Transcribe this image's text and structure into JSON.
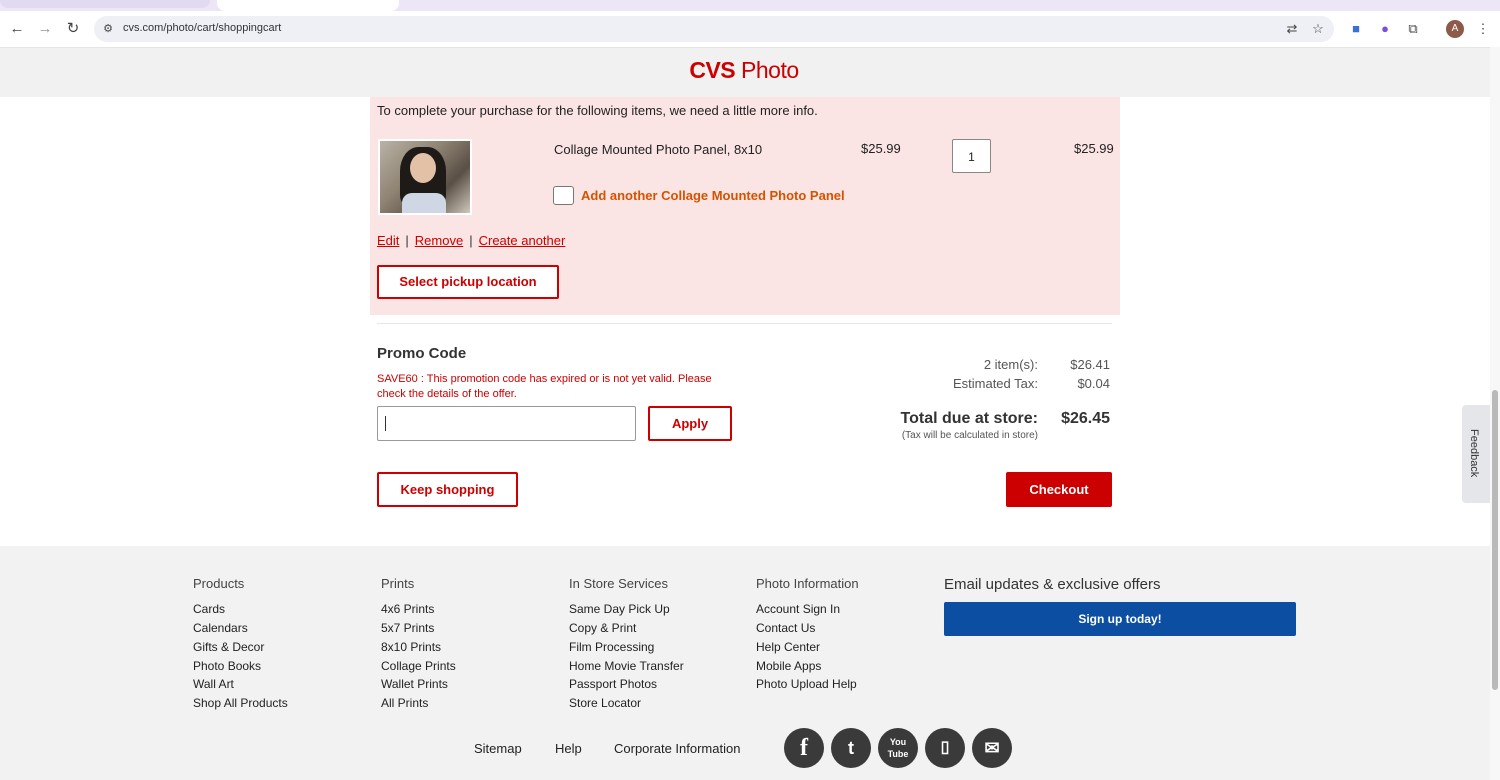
{
  "browser": {
    "url": "cvs.com/photo/cart/shoppingcart",
    "profile_initial": "A"
  },
  "header": {
    "logo_brand": "CVS",
    "logo_product": "Photo"
  },
  "cart": {
    "info_message": "To complete your purchase for the following items, we need a little more info.",
    "item": {
      "name": "Collage Mounted Photo Panel, 8x10",
      "price": "$25.99",
      "quantity": "1",
      "line_total": "$25.99",
      "add_another_label": "Add another Collage Mounted Photo Panel"
    },
    "actions": {
      "edit": "Edit",
      "remove": "Remove",
      "create_another": "Create another",
      "separator": "|"
    },
    "pickup_button": "Select pickup location"
  },
  "promo": {
    "title": "Promo Code",
    "error": "SAVE60 : This promotion code has expired or is not yet valid. Please check the details of the offer.",
    "input_value": "",
    "apply_label": "Apply"
  },
  "summary": {
    "items_label": "2 item(s):",
    "items_value": "$26.41",
    "tax_label": "Estimated Tax:",
    "tax_value": "$0.04",
    "total_label": "Total due at store:",
    "total_value": "$26.45",
    "tax_note": "(Tax will be calculated in store)"
  },
  "buttons": {
    "keep_shopping": "Keep shopping",
    "checkout": "Checkout"
  },
  "feedback_tab": "Feedback",
  "footer": {
    "columns": [
      {
        "heading": "Products",
        "links": [
          "Cards",
          "Calendars",
          "Gifts & Decor",
          "Photo Books",
          "Wall Art",
          "Shop All Products"
        ]
      },
      {
        "heading": "Prints",
        "links": [
          "4x6 Prints",
          "5x7 Prints",
          "8x10 Prints",
          "Collage Prints",
          "Wallet Prints",
          "All Prints"
        ]
      },
      {
        "heading": "In Store Services",
        "links": [
          "Same Day Pick Up",
          "Copy & Print",
          "Film Processing",
          "Home Movie Transfer",
          "Passport Photos",
          "Store Locator"
        ]
      },
      {
        "heading": "Photo Information",
        "links": [
          "Account Sign In",
          "Contact Us",
          "Help Center",
          "Mobile Apps",
          "Photo Upload Help"
        ]
      }
    ],
    "email_heading": "Email updates & exclusive offers",
    "signup_label": "Sign up today!",
    "bottom_links": [
      "Sitemap",
      "Help",
      "Corporate Information"
    ],
    "social_icons": [
      "facebook-icon",
      "twitter-icon",
      "youtube-icon",
      "mobile-icon",
      "email-icon"
    ]
  }
}
